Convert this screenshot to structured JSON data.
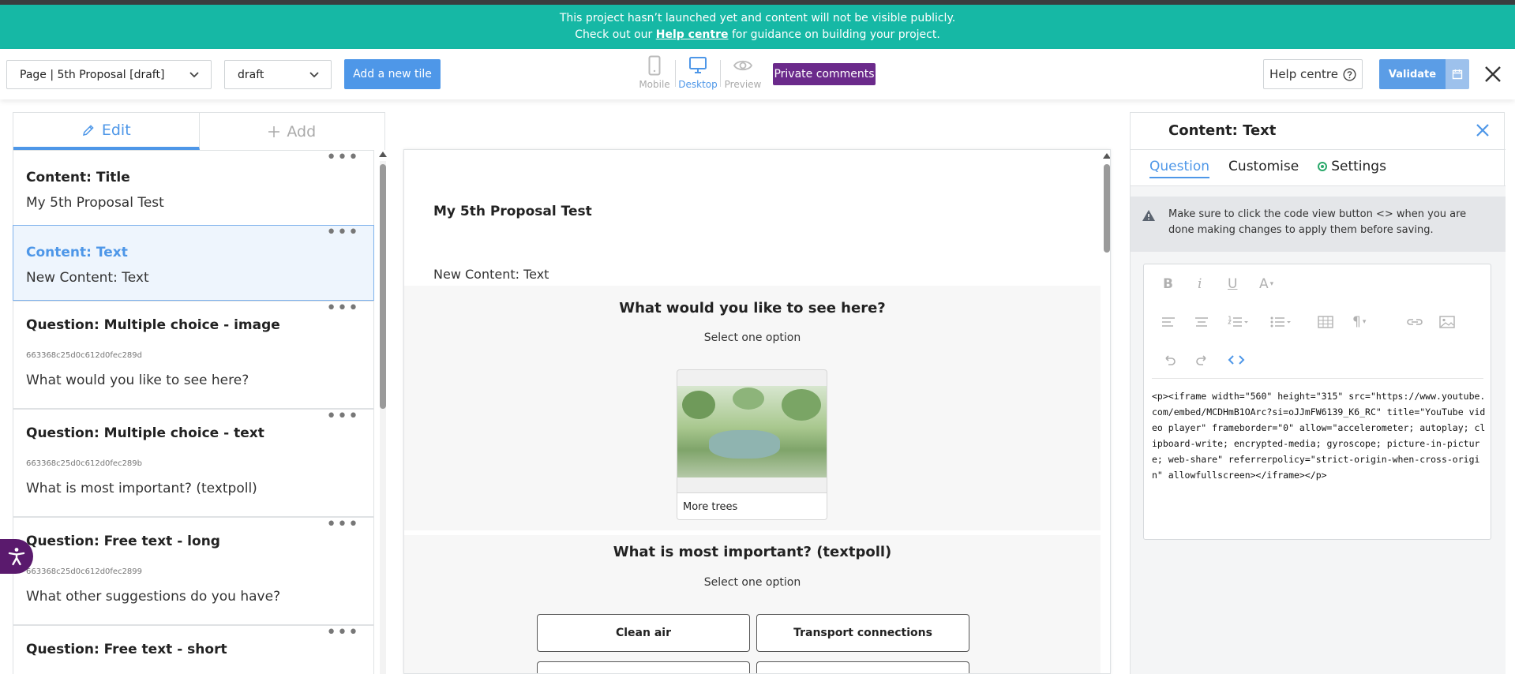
{
  "banner": {
    "line1": "This project hasn’t launched yet and content will not be visible publicly.",
    "line2_prefix": "Check out our",
    "help_link": "Help centre",
    "line2_suffix": "for guidance on building your project."
  },
  "toolbar": {
    "page_select": "Page | 5th Proposal [draft]",
    "status_select": "draft",
    "add_tile_label": "Add a new tile",
    "devices": [
      {
        "label": "Mobile"
      },
      {
        "label": "Desktop"
      },
      {
        "label": "Preview"
      }
    ],
    "private_comments_label": "Private comments",
    "help_centre_label": "Help centre",
    "validate_label": "Validate"
  },
  "left_panel": {
    "tabs": [
      {
        "label": "Edit",
        "icon": "pencil-icon"
      },
      {
        "label": "Add",
        "icon": "plus-icon"
      }
    ],
    "tiles": [
      {
        "title": "Content: Title",
        "subtitle": "My 5th Proposal Test"
      },
      {
        "title": "Content: Text",
        "subtitle": "New Content: Text"
      },
      {
        "title": "Question: Multiple choice - image",
        "id": "663368c25d0c612d0fec289d",
        "subtitle": "What would you like to see here?"
      },
      {
        "title": "Question: Multiple choice - text",
        "id": "663368c25d0c612d0fec289b",
        "subtitle": "What is most important? (textpoll)"
      },
      {
        "title": "Question: Free text - long",
        "id": "663368c25d0c612d0fec2899",
        "subtitle": "What other suggestions do you have?"
      },
      {
        "title": "Question: Free text - short"
      }
    ]
  },
  "preview": {
    "title": "My 5th Proposal Test",
    "text": "New Content: Text",
    "q1": {
      "title": "What would you like to see here?",
      "sub": "Select one option",
      "image_option": "More trees"
    },
    "q2": {
      "title": "What is most important? (textpoll)",
      "sub": "Select one option",
      "options": [
        "Clean air",
        "Transport connections"
      ]
    }
  },
  "right_panel": {
    "title": "Content: Text",
    "tabs": [
      "Question",
      "Customise",
      "Settings"
    ],
    "notice": "Make sure to click the code view button <> when you are done making changes to apply them before saving.",
    "code": "<p><iframe width=\"560\" height=\"315\" src=\"https://www.youtube.com/embed/MCDHmB1OArc?si=oJJmFW6139_K6_RC\" title=\"YouTube video player\" frameborder=\"0\" allow=\"accelerometer; autoplay; clipboard-write; encrypted-media; gyroscope; picture-in-picture; web-share\" referrerpolicy=\"strict-origin-when-cross-origin\" allowfullscreen></iframe></p>"
  },
  "colors": {
    "banner": "#16b8a5",
    "accent": "#4e97e8",
    "purple": "#6b2a8b",
    "a11y": "#5a1a6d"
  }
}
